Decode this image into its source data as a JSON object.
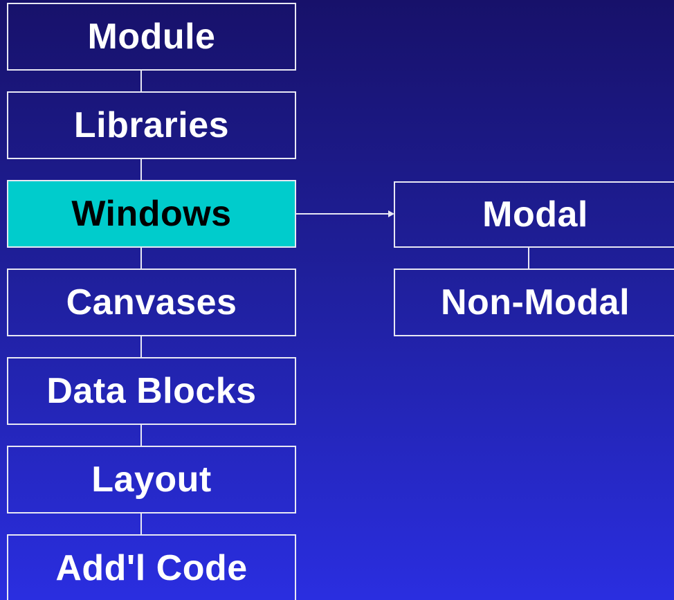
{
  "diagram": {
    "main_column": [
      {
        "label": "Module",
        "highlighted": false
      },
      {
        "label": "Libraries",
        "highlighted": false
      },
      {
        "label": "Windows",
        "highlighted": true
      },
      {
        "label": "Canvases",
        "highlighted": false
      },
      {
        "label": "Data Blocks",
        "highlighted": false
      },
      {
        "label": "Layout",
        "highlighted": false
      },
      {
        "label": "Add'l Code",
        "highlighted": false
      }
    ],
    "sub_column": [
      {
        "label": "Modal"
      },
      {
        "label": "Non-Modal"
      }
    ]
  },
  "colors": {
    "background_top": "#17116a",
    "background_bottom": "#2a2ee0",
    "highlight": "#00cccc",
    "border": "#e8e8f4",
    "text": "#ffffff"
  }
}
